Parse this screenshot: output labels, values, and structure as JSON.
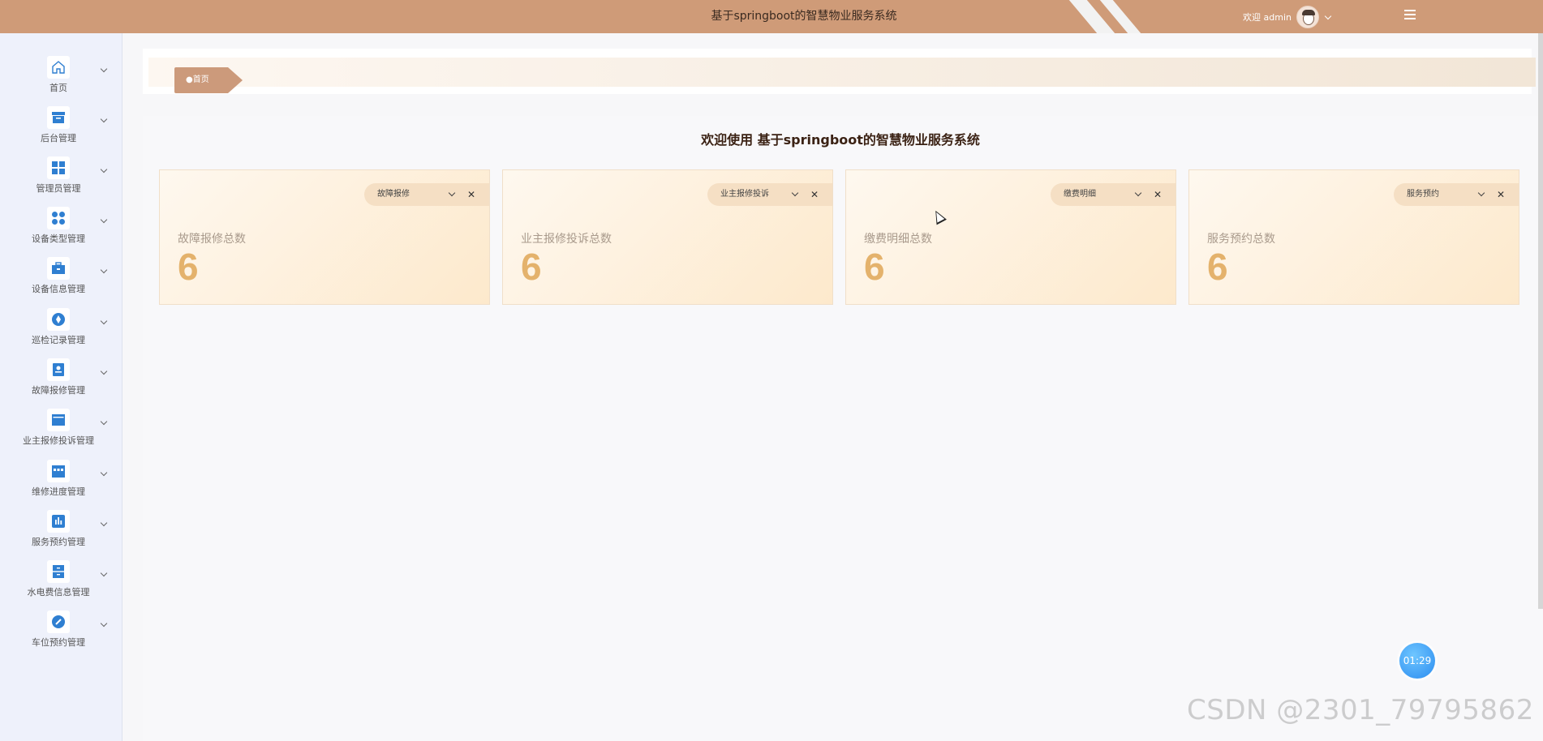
{
  "header": {
    "app_title": "基于springboot的智慧物业服务系统",
    "welcome_text": "欢迎 admin"
  },
  "sidebar": {
    "items": [
      {
        "label": "首页",
        "icon": "home-icon"
      },
      {
        "label": "后台管理",
        "icon": "archive-icon"
      },
      {
        "label": "管理员管理",
        "icon": "grid-icon"
      },
      {
        "label": "设备类型管理",
        "icon": "circles-icon"
      },
      {
        "label": "设备信息管理",
        "icon": "toolbox-icon"
      },
      {
        "label": "巡检记录管理",
        "icon": "compass-icon"
      },
      {
        "label": "故障报修管理",
        "icon": "badge-icon"
      },
      {
        "label": "业主报修投诉管理",
        "icon": "window-icon"
      },
      {
        "label": "维修进度管理",
        "icon": "calendar-icon"
      },
      {
        "label": "服务预约管理",
        "icon": "chart-icon"
      },
      {
        "label": "水电费信息管理",
        "icon": "cabinet-icon"
      },
      {
        "label": "车位预约管理",
        "icon": "pencil-icon"
      }
    ]
  },
  "breadcrumb": {
    "home": "●首页"
  },
  "main": {
    "welcome_title": "欢迎使用 基于springboot的智慧物业服务系统",
    "cards": [
      {
        "pill": "故障报修",
        "label": "故障报修总数",
        "value": "6"
      },
      {
        "pill": "业主报修投诉",
        "label": "业主报修投诉总数",
        "value": "6"
      },
      {
        "pill": "缴费明细",
        "label": "缴费明细总数",
        "value": "6"
      },
      {
        "pill": "服务预约",
        "label": "服务预约总数",
        "value": "6"
      }
    ],
    "close_glyph": "✕"
  },
  "timer": "01:29",
  "watermark": "CSDN @2301_79795862",
  "colors": {
    "header": "#cf9b78",
    "accent_value": "#e4b26c",
    "icon_blue": "#2f7fd1"
  }
}
